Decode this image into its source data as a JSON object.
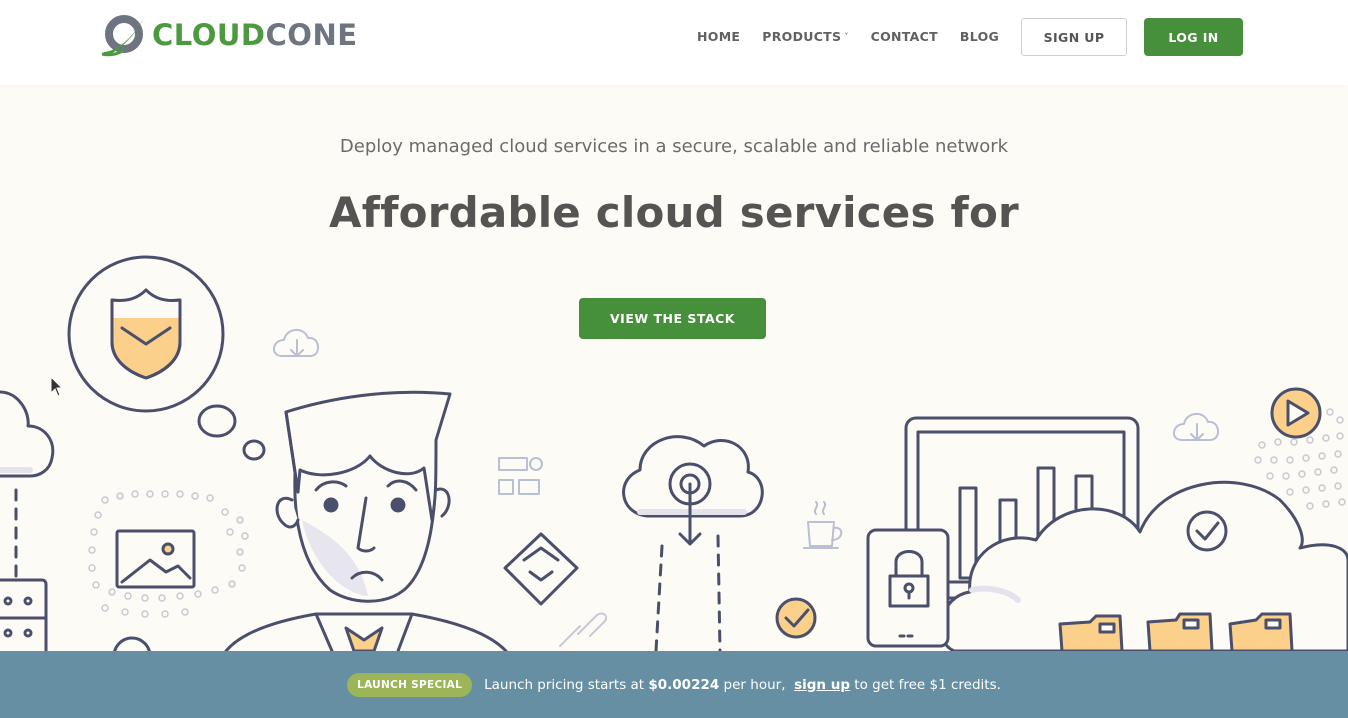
{
  "brand": {
    "name_part1": "CLOUD",
    "name_part2": "CONE",
    "logo_icon": "cloudcone-swoosh-logo-icon",
    "colors": {
      "green": "#468f3b",
      "gray": "#6e7580"
    }
  },
  "nav": {
    "items": [
      {
        "label": "HOME"
      },
      {
        "label": "PRODUCTS",
        "caret": "˅"
      },
      {
        "label": "CONTACT"
      },
      {
        "label": "BLOG"
      }
    ],
    "signup_label": "SIGN UP",
    "login_label": "LOG IN"
  },
  "hero": {
    "subtitle": "Deploy managed cloud services in a secure, scalable and reliable network",
    "headline": "Affordable cloud services for",
    "cta_label": "VIEW THE STACK",
    "illustration_icons": [
      "shield-icon",
      "cloud-download-icon",
      "image-icon",
      "flowchart-icon",
      "diamond-direction-icon",
      "cloud-upload-icon",
      "coffee-cup-icon",
      "check-circle-icon",
      "padlock-icon",
      "bar-chart-monitor-icon",
      "link-icon",
      "folder-icon",
      "play-button-icon",
      "server-icon"
    ]
  },
  "banner": {
    "badge": "LAUNCH SPECIAL",
    "text_before": "Launch pricing starts at ",
    "price": "$0.00224",
    "text_mid": " per hour,  ",
    "link_label": "sign up",
    "text_after": " to get free $1 credits.",
    "colors": {
      "background": "#668fa3",
      "badge": "#9bb558"
    }
  }
}
